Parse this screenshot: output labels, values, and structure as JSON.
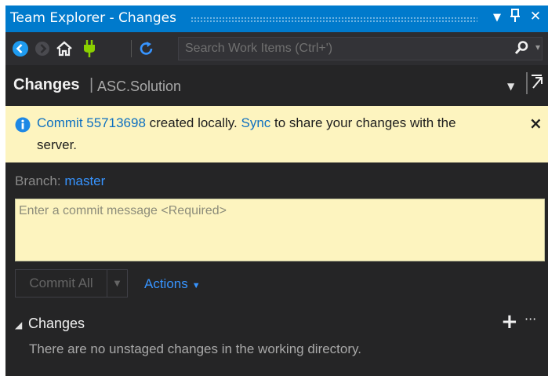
{
  "window": {
    "title": "Team Explorer - Changes"
  },
  "colors": {
    "accent": "#007acc",
    "link": "#3794ff",
    "info_bar": "#fdf4bf",
    "background": "#252526"
  },
  "toolbar": {
    "buttons": [
      {
        "name": "back",
        "icon": "back-arrow-icon"
      },
      {
        "name": "forward",
        "icon": "forward-arrow-icon"
      },
      {
        "name": "home",
        "icon": "home-icon"
      },
      {
        "name": "connect",
        "icon": "plug-icon"
      },
      {
        "name": "refresh",
        "icon": "refresh-icon"
      }
    ],
    "search": {
      "placeholder": "Search Work Items (Ctrl+')"
    }
  },
  "page": {
    "title": "Changes",
    "separator": "|",
    "context": "ASC.Solution"
  },
  "info_bar": {
    "commit_link": "Commit 55713698",
    "text_created": " created locally. ",
    "sync_link": "Sync",
    "text_rest": " to share your changes with the",
    "text_line2": "server.",
    "close_label": "×"
  },
  "branch": {
    "label": "Branch:",
    "value": "master"
  },
  "commit_message": {
    "placeholder": "Enter a commit message <Required>",
    "value": ""
  },
  "buttons": {
    "commit_all": "Commit All",
    "actions": "Actions"
  },
  "changes_section": {
    "title": "Changes",
    "empty_message": "There are no unstaged changes in the working directory."
  }
}
